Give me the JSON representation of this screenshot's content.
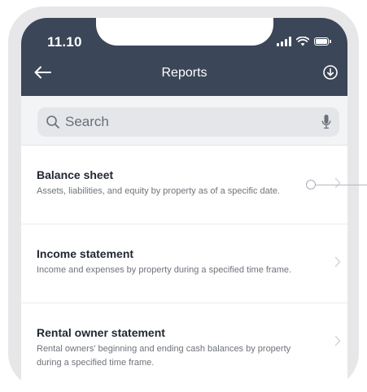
{
  "status_bar": {
    "time": "11.10"
  },
  "header": {
    "title": "Reports"
  },
  "search": {
    "placeholder": "Search"
  },
  "reports": [
    {
      "title": "Balance sheet",
      "description": "Assets, liabilities, and equity by property as of a specific date."
    },
    {
      "title": "Income statement",
      "description": "Income and expenses by property during a specified time frame."
    },
    {
      "title": "Rental owner statement",
      "description": "Rental owners' beginning and ending cash balances by property during a specified time frame."
    }
  ],
  "colors": {
    "header_bg": "#3b4658",
    "search_bg": "#f3f4f6",
    "field_bg": "#e4e6ea"
  },
  "icons": [
    "back-arrow-icon",
    "download-icon",
    "search-icon",
    "microphone-icon",
    "chevron-right-icon",
    "cellular-signal-icon",
    "wifi-icon",
    "battery-icon"
  ]
}
